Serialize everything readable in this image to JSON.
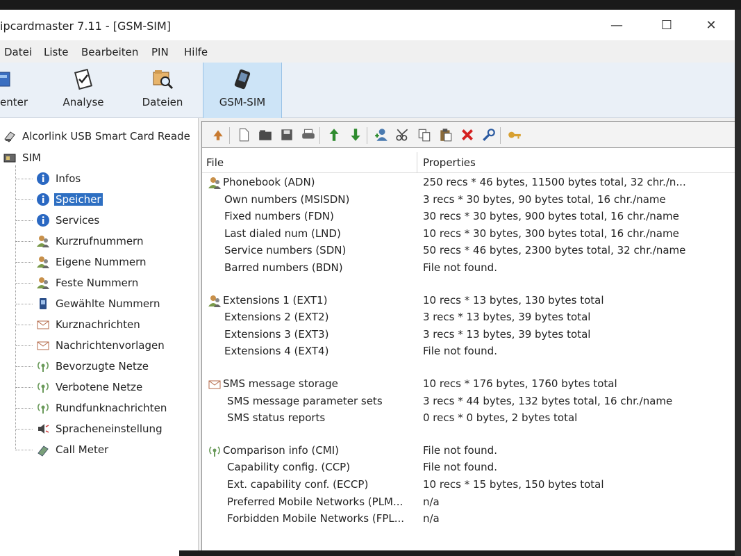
{
  "window": {
    "title": "ipcardmaster 7.11 - [GSM-SIM]",
    "minimize": "—",
    "maximize": "☐",
    "close": "✕"
  },
  "menu": [
    "Datei",
    "Liste",
    "Bearbeiten",
    "PIN",
    "Hilfe"
  ],
  "big_toolbar": [
    {
      "label": "enter",
      "icon": "reader-icon"
    },
    {
      "label": "Analyse",
      "icon": "analyse-icon"
    },
    {
      "label": "Dateien",
      "icon": "files-search-icon"
    },
    {
      "label": "GSM-SIM",
      "icon": "sim-phone-icon",
      "active": true
    }
  ],
  "tree": {
    "reader": "Alcorlink USB Smart Card Reade",
    "root": "SIM",
    "items": [
      {
        "label": "Infos",
        "icon": "info-icon"
      },
      {
        "label": "Speicher",
        "icon": "info-icon",
        "selected": true
      },
      {
        "label": "Services",
        "icon": "info-icon"
      },
      {
        "label": "Kurzrufnummern",
        "icon": "contacts-icon"
      },
      {
        "label": "Eigene Nummern",
        "icon": "contacts-icon"
      },
      {
        "label": "Feste Nummern",
        "icon": "contacts-icon"
      },
      {
        "label": "Gewählte Nummern",
        "icon": "phone-log-icon"
      },
      {
        "label": "Kurznachrichten",
        "icon": "envelope-icon"
      },
      {
        "label": "Nachrichtenvorlagen",
        "icon": "envelope-icon"
      },
      {
        "label": "Bevorzugte Netze",
        "icon": "antenna-icon"
      },
      {
        "label": "Verbotene Netze",
        "icon": "antenna-icon"
      },
      {
        "label": "Rundfunknachrichten",
        "icon": "antenna-icon"
      },
      {
        "label": "Spracheneinstellung",
        "icon": "speaker-icon"
      },
      {
        "label": "Call Meter",
        "icon": "call-meter-icon"
      }
    ]
  },
  "list": {
    "col_file": "File",
    "col_properties": "Properties",
    "rows": [
      {
        "file": "Phonebook (ADN)",
        "props": "250 recs * 46 bytes,   11500 bytes total,   32 chr./n...",
        "icon": "contacts-icon"
      },
      {
        "file": "Own numbers (MSISDN)",
        "props": "3 recs * 30 bytes,   90 bytes total,   16 chr./name"
      },
      {
        "file": "Fixed numbers (FDN)",
        "props": "30 recs * 30 bytes,   900 bytes total,   16 chr./name"
      },
      {
        "file": "Last dialed num (LND)",
        "props": "10 recs * 30 bytes,   300 bytes total,   16 chr./name"
      },
      {
        "file": "Service numbers (SDN)",
        "props": "50 recs * 46 bytes,   2300 bytes total,   32 chr./name"
      },
      {
        "file": "Barred numbers (BDN)",
        "props": "File not found."
      },
      {
        "file": "Extensions 1 (EXT1)",
        "props": "10 recs * 13 bytes,   130 bytes total",
        "icon": "contacts-icon"
      },
      {
        "file": "Extensions 2 (EXT2)",
        "props": "3 recs * 13 bytes,   39 bytes total"
      },
      {
        "file": "Extensions 3 (EXT3)",
        "props": "3 recs * 13 bytes,   39 bytes total"
      },
      {
        "file": "Extensions 4 (EXT4)",
        "props": "File not found."
      },
      {
        "file": "SMS message storage",
        "props": "10 recs * 176 bytes,   1760 bytes total",
        "icon": "envelope-icon"
      },
      {
        "file": "SMS message parameter sets",
        "props": "3 recs * 44 bytes,   132 bytes total,   16 chr./name"
      },
      {
        "file": "SMS status reports",
        "props": "0 recs * 0 bytes,   2 bytes total"
      },
      {
        "file": "Comparison info (CMI)",
        "props": "File not found.",
        "icon": "antenna-icon"
      },
      {
        "file": "Capability config. (CCP)",
        "props": "File not found."
      },
      {
        "file": "Ext. capability conf. (ECCP)",
        "props": "10 recs * 15 bytes,   150 bytes total"
      },
      {
        "file": "Preferred Mobile Networks (PLM...",
        "props": "n/a"
      },
      {
        "file": "Forbidden Mobile Networks (FPL...",
        "props": "n/a"
      }
    ]
  },
  "small_toolbar": [
    "refresh-icon",
    "new-file-icon",
    "open-folder-icon",
    "save-icon",
    "print-icon",
    "arrow-up-icon",
    "arrow-down-icon",
    "add-contact-icon",
    "cut-icon",
    "copy-icon",
    "paste-icon",
    "delete-icon",
    "search-key-icon",
    "key-icon"
  ],
  "colors": {
    "selection": "#2e6fc2",
    "active_tab": "#cde4f7",
    "info_blue": "#2a68c2",
    "green_arrow": "#2e8b2e",
    "red_x": "#d42020"
  }
}
